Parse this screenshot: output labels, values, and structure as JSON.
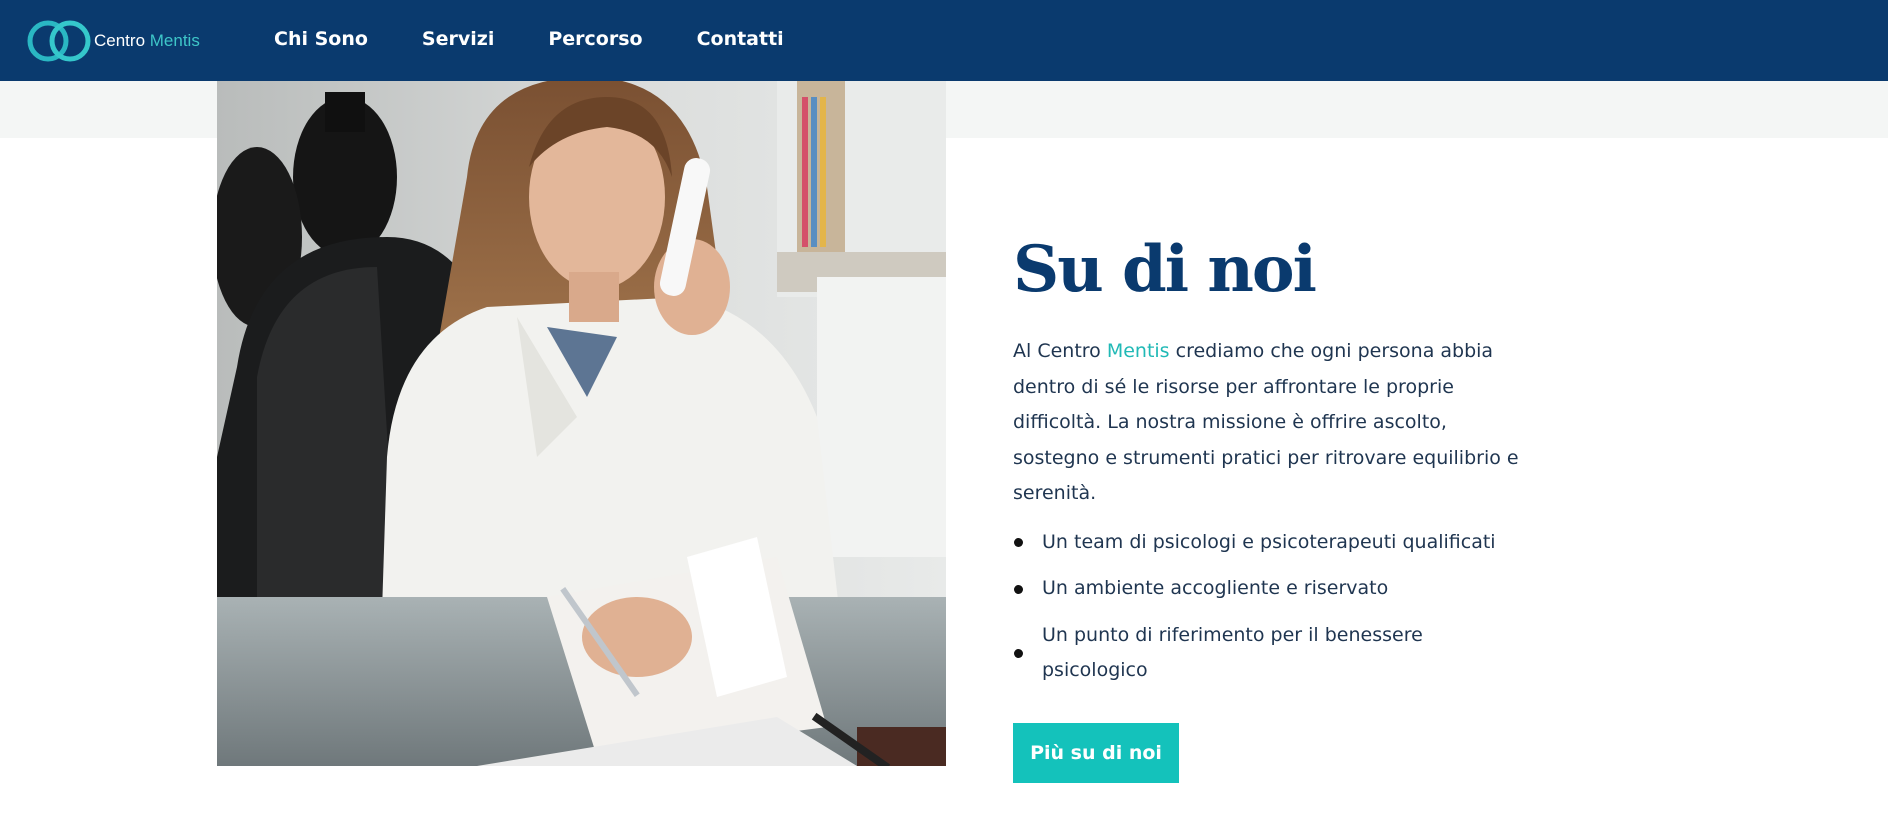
{
  "brand": {
    "name_part1": "Centro",
    "name_part2": "Mentis",
    "primary_color": "#0a3a6e",
    "accent_color": "#14c2bb"
  },
  "nav": {
    "items": [
      {
        "label": "Chi Sono"
      },
      {
        "label": "Servizi"
      },
      {
        "label": "Percorso"
      },
      {
        "label": "Contatti"
      }
    ]
  },
  "about": {
    "title": "Su di noi",
    "intro_before": "Al Centro ",
    "intro_highlight": "Mentis",
    "intro_after": " crediamo che ogni persona abbia dentro di sé le risorse per affrontare le proprie difficoltà. La nostra missione è offrire ascolto, sostegno e strumenti pratici per ritrovare equilibrio e serenità.",
    "features": [
      "Un team di psicologi e psicoterapeuti qualificati",
      "Un ambiente accogliente e riservato",
      "Un punto di riferimento per il benessere psicologico"
    ],
    "cta_label": "Più su di noi",
    "image_icon": "photo-therapist-on-phone"
  }
}
